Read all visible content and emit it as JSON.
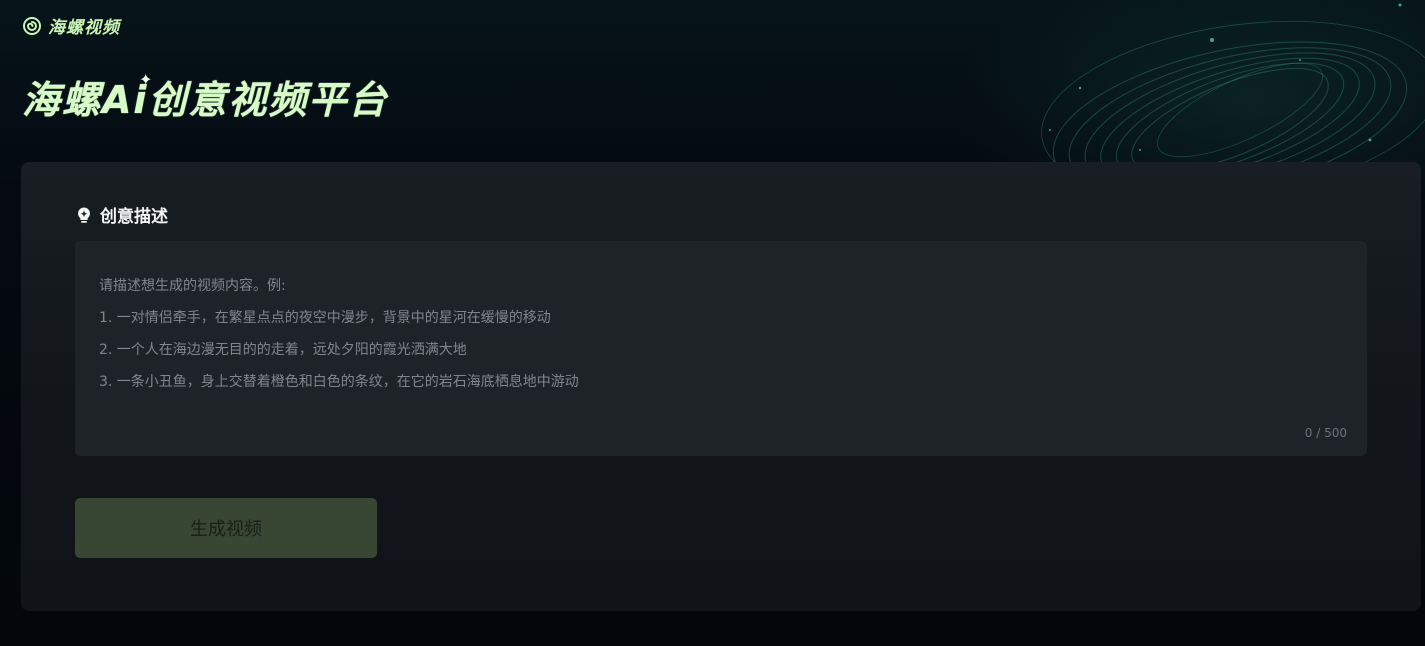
{
  "header": {
    "logo_text": "海螺视频",
    "logo_icon": "snail-shell-icon",
    "hero_title": "海螺Ai创意视频平台"
  },
  "form": {
    "section_icon": "lightbulb-icon",
    "section_title": "创意描述",
    "description_value": "",
    "description_placeholder": "请描述想生成的视频内容。例:\n1. 一对情侣牵手，在繁星点点的夜空中漫步，背景中的星河在缓慢的移动\n2. 一个人在海边漫无目的的走着，远处夕阳的霞光洒满大地\n3. 一条小丑鱼，身上交替着橙色和白色的条纹，在它的岩石海底栖息地中游动",
    "char_count": "0 / 500",
    "generate_button_label": "生成视频",
    "generate_button_enabled": false
  },
  "colors": {
    "brand_accent": "#c8f5b4",
    "page_background": "#03070c",
    "card_background": "#15191d",
    "button_disabled": "#3a4a35"
  }
}
